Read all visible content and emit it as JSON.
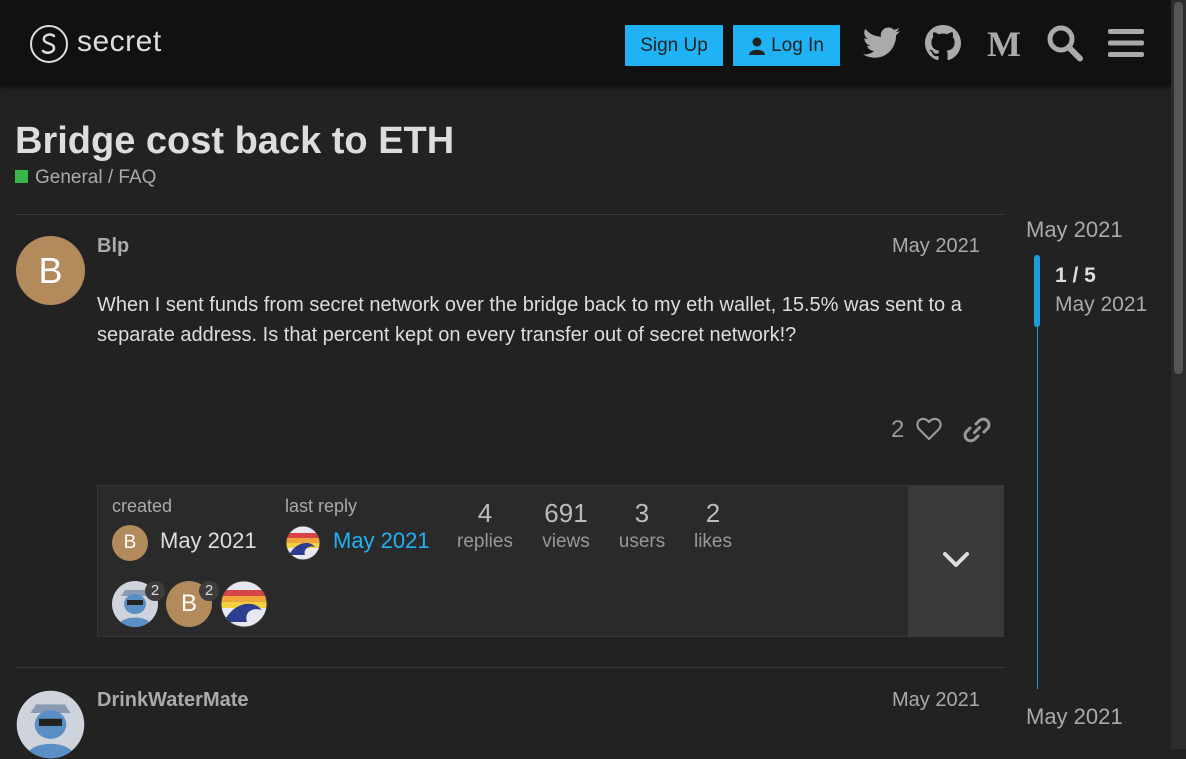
{
  "header": {
    "logo_text": "secret",
    "signup_label": "Sign Up",
    "login_label": "Log In",
    "icons": [
      "twitter-icon",
      "github-icon",
      "medium-icon",
      "search-icon",
      "hamburger-menu-icon"
    ]
  },
  "topic": {
    "title": "Bridge cost back to ETH",
    "category": "General / FAQ",
    "category_color": "#3ab54a"
  },
  "posts": [
    {
      "avatar_letter": "B",
      "username": "Blp",
      "date": "May 2021",
      "body": "When I sent funds from secret network over the bridge back to my eth wallet, 15.5% was sent to a separate address. Is that percent kept on every transfer out of secret network!?",
      "likes": "2"
    },
    {
      "username": "DrinkWaterMate",
      "date": "May 2021"
    }
  ],
  "topic_map": {
    "created_label": "created",
    "created_avatar_letter": "B",
    "created_date": "May 2021",
    "last_reply_label": "last reply",
    "last_reply_date": "May 2021",
    "stats": [
      {
        "num": "4",
        "label": "replies"
      },
      {
        "num": "691",
        "label": "views"
      },
      {
        "num": "3",
        "label": "users"
      },
      {
        "num": "2",
        "label": "likes"
      }
    ],
    "participants": [
      {
        "count": "2"
      },
      {
        "letter": "B",
        "count": "2"
      },
      {}
    ]
  },
  "timeline": {
    "start_date": "May 2021",
    "counter": "1 / 5",
    "counter_date": "May 2021",
    "end_date": "May 2021"
  },
  "colors": {
    "accent": "#1fb3f6",
    "timeline": "#1f9bdc",
    "link": "#1fb3f6"
  }
}
